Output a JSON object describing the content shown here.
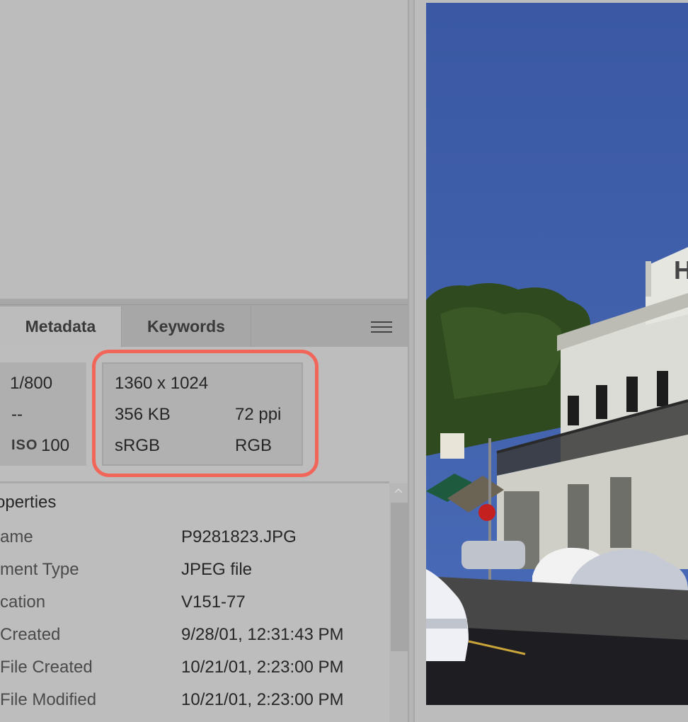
{
  "tabs": {
    "metadata": "Metadata",
    "keywords": "Keywords"
  },
  "exposure": {
    "shutter": "1/800",
    "aperture": "--",
    "iso_label": "ISO",
    "iso_value": "100"
  },
  "file_info": {
    "dimensions": "1360 x 1024",
    "size": "356 KB",
    "resolution": "72 ppi",
    "color_profile": "sRGB",
    "color_mode": "RGB"
  },
  "properties": {
    "title": "operties",
    "rows": [
      {
        "label": "ame",
        "value": "P9281823.JPG"
      },
      {
        "label": "ment Type",
        "value": "JPEG file"
      },
      {
        "label": "cation",
        "value": "V151-77"
      },
      {
        "label": "Created",
        "value": "9/28/01, 12:31:43 PM"
      },
      {
        "label": "File Created",
        "value": "10/21/01, 2:23:00 PM"
      },
      {
        "label": "File Modified",
        "value": "10/21/01, 2:23:00 PM"
      }
    ]
  },
  "preview": {
    "sign_text": "H"
  },
  "colors": {
    "highlight": "#f2665a",
    "sky": "#3b5aa3"
  }
}
